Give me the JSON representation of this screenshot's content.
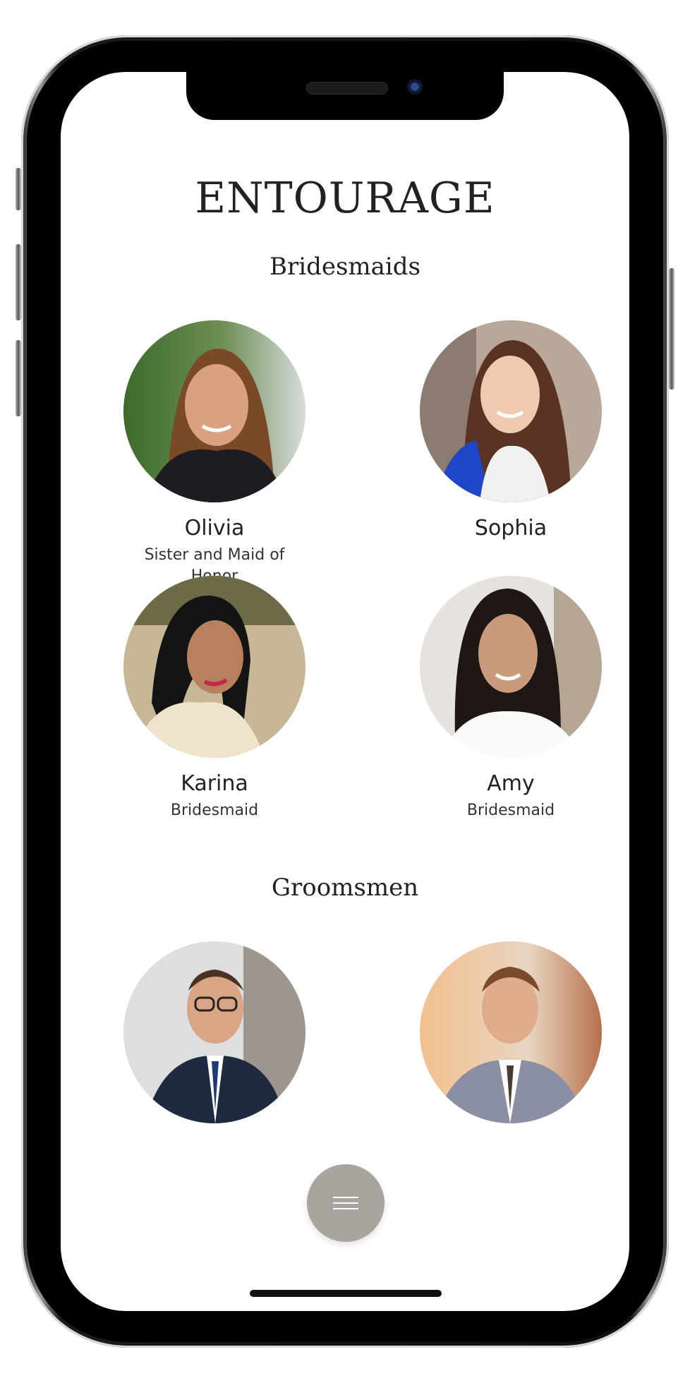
{
  "page": {
    "title": "ENTOURAGE"
  },
  "sections": {
    "bridesmaids": {
      "title": "Bridesmaids",
      "members": [
        {
          "name": "Olivia",
          "role": "Sister and Maid of Honor"
        },
        {
          "name": "Sophia",
          "role": ""
        },
        {
          "name": "Karina",
          "role": "Bridesmaid"
        },
        {
          "name": "Amy",
          "role": "Bridesmaid"
        }
      ]
    },
    "groomsmen": {
      "title": "Groomsmen"
    }
  },
  "menu_button": {
    "icon": "menu-icon"
  },
  "colors": {
    "fab": "#a9a49e",
    "text": "#222222",
    "background": "#ffffff"
  }
}
